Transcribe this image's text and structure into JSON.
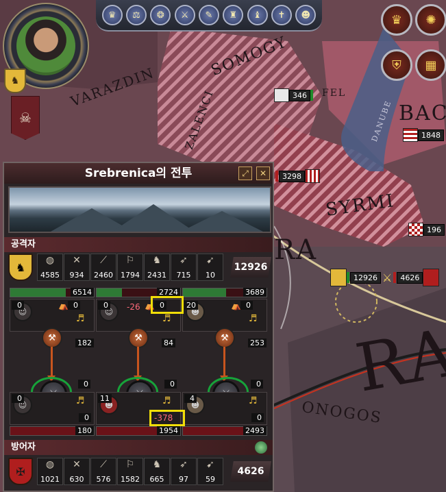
{
  "map": {
    "labels": [
      "VARAZDIN",
      "SOMOGY",
      "ZALENCI",
      "DANUBE",
      "SYRMI",
      "RA",
      "RA",
      "ONOGOS"
    ],
    "partial_label": "BAC",
    "armies": [
      {
        "num": "346",
        "color": "#1f8a2a"
      },
      {
        "num": "1848",
        "color": "#b01e1e"
      },
      {
        "num": "3298",
        "color": "#b01e1e"
      },
      {
        "num": "196",
        "color": "#b01e1e"
      },
      {
        "num": "12926",
        "color": "#1f8a2a"
      },
      {
        "num": "4626",
        "color": "#b01e1e"
      }
    ],
    "fel_text": "FEL",
    "right_buttons": [
      "crown-icon",
      "realm-icon",
      "shield-icon",
      "map-icon"
    ]
  },
  "topbar": {
    "buttons": [
      "♛",
      "⚖",
      "❂",
      "⚔",
      "✎",
      "♜",
      "♝",
      "✝",
      "☻"
    ]
  },
  "battle": {
    "title": "Srebrenica의 전투",
    "attacker": {
      "label": "공격자",
      "troops": [
        {
          "icon": "light-infantry-icon",
          "glyph": "◍",
          "value": "4585"
        },
        {
          "icon": "heavy-infantry-icon",
          "glyph": "✕",
          "value": "934"
        },
        {
          "icon": "pikemen-icon",
          "glyph": "⟋",
          "value": "2460"
        },
        {
          "icon": "light-cavalry-icon",
          "glyph": "⚐",
          "value": "1794"
        },
        {
          "icon": "knights-icon",
          "glyph": "♞",
          "value": "2431"
        },
        {
          "icon": "archers-icon",
          "glyph": "➶",
          "value": "715"
        },
        {
          "icon": "horse-archers-icon",
          "glyph": "➹",
          "value": "10"
        }
      ],
      "total": "12926",
      "flanks": [
        {
          "hp": "6514",
          "hp_frac": 0.66,
          "cmd_num": "0",
          "sub": "0",
          "troops": "182",
          "dmg": ""
        },
        {
          "hp": "2724",
          "hp_frac": 0.3,
          "cmd_num": "0",
          "sub": "0",
          "troops": "84",
          "dmg": "-26"
        },
        {
          "hp": "3689",
          "hp_frac": 0.52,
          "cmd_num": "20",
          "sub": "0",
          "troops": "253",
          "dmg": ""
        }
      ]
    },
    "defender": {
      "label": "방어자",
      "troops": [
        {
          "icon": "light-infantry-icon",
          "glyph": "◍",
          "value": "1021"
        },
        {
          "icon": "heavy-infantry-icon",
          "glyph": "✕",
          "value": "630"
        },
        {
          "icon": "pikemen-icon",
          "glyph": "⟋",
          "value": "576"
        },
        {
          "icon": "light-cavalry-icon",
          "glyph": "⚐",
          "value": "1582"
        },
        {
          "icon": "knights-icon",
          "glyph": "♞",
          "value": "665"
        },
        {
          "icon": "archers-icon",
          "glyph": "➶",
          "value": "97"
        },
        {
          "icon": "horse-archers-icon",
          "glyph": "➹",
          "value": "59"
        }
      ],
      "total": "4626",
      "flanks": [
        {
          "skill_num": "0",
          "cmd_num": "0",
          "sub": "0",
          "troops": "180",
          "dmg": ""
        },
        {
          "skill_num": "0",
          "cmd_num": "11",
          "sub": "",
          "troops": "1954",
          "dmg": "-378"
        },
        {
          "skill_num": "0",
          "cmd_num": "4",
          "sub": "0",
          "troops": "2493",
          "dmg": ""
        }
      ]
    },
    "colors": {
      "attacker": "#e3b83a",
      "defender": "#b01e1e",
      "highlight": "#f1de08",
      "ring": "#17a33a"
    }
  }
}
